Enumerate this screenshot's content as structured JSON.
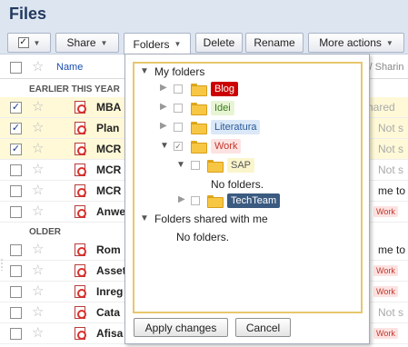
{
  "app": {
    "title": "Files"
  },
  "toolbar": {
    "share": "Share",
    "folders": "Folders",
    "delete": "Delete",
    "rename": "Rename",
    "more_actions": "More actions"
  },
  "columns": {
    "name": "Name",
    "right": "s / Sharin"
  },
  "sections": {
    "earlier": "EARLIER THIS YEAR",
    "older": "OLDER"
  },
  "rows": [
    {
      "name": "MBA",
      "checked": "✓",
      "right": "hared"
    },
    {
      "name": "Plan",
      "checked": "✓",
      "right": "Not s"
    },
    {
      "name": "MCR",
      "checked": "✓",
      "right": "Not s"
    },
    {
      "name": "MCR",
      "checked": "",
      "right": "Not s"
    },
    {
      "name": "MCR",
      "checked": "",
      "right": "me to"
    },
    {
      "name": "Anwe",
      "checked": "",
      "right": "Work"
    },
    {
      "name": "Rom",
      "checked": "",
      "right": "me to"
    },
    {
      "name": "Asset",
      "checked": "",
      "right": "Work"
    },
    {
      "name": "Inreg",
      "checked": "",
      "right": "Work"
    },
    {
      "name": "Cata",
      "checked": "",
      "right": "Not s"
    },
    {
      "name": "Afisa",
      "checked": "",
      "right": "Work"
    }
  ],
  "folders_menu": {
    "my_folders": "My folders",
    "items": [
      {
        "label": "Blog",
        "bg": "#cc0000",
        "fg": "#ffffff"
      },
      {
        "label": "Idei",
        "bg": "#e8f5d5",
        "fg": "#3a7a1a"
      },
      {
        "label": "Literatura",
        "bg": "#dbe8f7",
        "fg": "#2a5a9a"
      },
      {
        "label": "Work",
        "bg": "#fde2e2",
        "fg": "#c0392b",
        "partial": "✓"
      },
      {
        "label": "SAP",
        "bg": "#fbf5cc",
        "fg": "#555555"
      },
      {
        "label": "TechTeam",
        "bg": "#3b5a80",
        "fg": "#ffffff"
      }
    ],
    "sap_empty": "No folders.",
    "shared_with_me": "Folders shared with me",
    "shared_empty": "No folders.",
    "apply": "Apply changes",
    "cancel": "Cancel"
  }
}
